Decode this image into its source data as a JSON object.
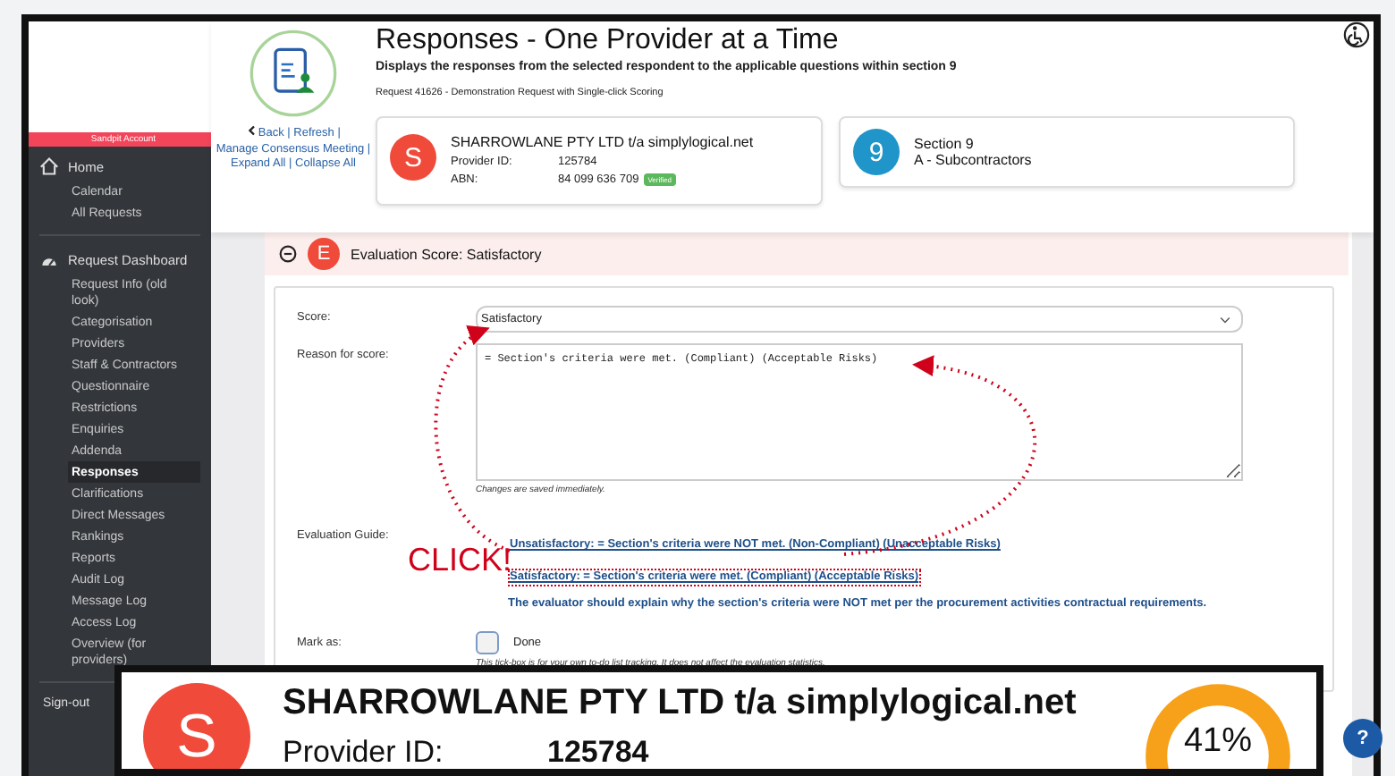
{
  "header": {
    "title": "Responses - One Provider at a Time",
    "subtitle": "Displays the responses from the selected respondent to the applicable questions within section 9",
    "request_line": "Request 41626 - Demonstration Request with Single-click Scoring",
    "links": [
      "Back",
      "Refresh",
      "Manage Consensus Meeting",
      "Expand All",
      "Collapse All"
    ],
    "link_separator": "|"
  },
  "provider_card": {
    "initial": "S",
    "name": "SHARROWLANE PTY LTD t/a simplylogical.net",
    "fields": [
      {
        "label": "Provider ID:",
        "value": "125784"
      },
      {
        "label": "ABN:",
        "value": "84 099 636 709",
        "badge": "Verified"
      }
    ]
  },
  "section_card": {
    "number": "9",
    "title": "Section 9",
    "subtitle": "A - Subcontractors"
  },
  "sidebar": {
    "banner": "Sandpit Account",
    "groups": [
      {
        "label": "Home",
        "children": [
          {
            "label": "Calendar",
            "selected": false
          },
          {
            "label": "All Requests",
            "selected": false
          }
        ]
      },
      {
        "label": "Request Dashboard",
        "children": [
          {
            "label": "Request Info (old look)",
            "selected": false
          },
          {
            "label": "Categorisation",
            "selected": false
          },
          {
            "label": "Providers",
            "selected": false
          },
          {
            "label": "Staff & Contractors",
            "selected": false
          },
          {
            "label": "Questionnaire",
            "selected": false
          },
          {
            "label": "Restrictions",
            "selected": false
          },
          {
            "label": "Enquiries",
            "selected": false
          },
          {
            "label": "Addenda",
            "selected": false
          },
          {
            "label": "Responses",
            "selected": true
          },
          {
            "label": "Clarifications",
            "selected": false
          },
          {
            "label": "Direct Messages",
            "selected": false
          },
          {
            "label": "Rankings",
            "selected": false
          },
          {
            "label": "Reports",
            "selected": false
          },
          {
            "label": "Audit Log",
            "selected": false
          },
          {
            "label": "Message Log",
            "selected": false
          },
          {
            "label": "Access Log",
            "selected": false
          },
          {
            "label": "Overview (for providers)",
            "selected": false
          }
        ]
      }
    ],
    "sign_out": "Sign-out"
  },
  "evaluation": {
    "badge": "E",
    "title": "Evaluation Score: Satisfactory",
    "expanded": true,
    "score_label": "Score:",
    "score_value": "Satisfactory",
    "reason_label": "Reason for score:",
    "reason_value": "= Section's criteria were met. (Compliant) (Acceptable Risks)",
    "reason_hint": "Changes are saved immediately.",
    "guide_label": "Evaluation Guide:",
    "guide_items": [
      {
        "text": "Unsatisfactory: = Section's criteria were NOT met.  (Non-Compliant) (Unacceptable Risks)",
        "highlighted": false
      },
      {
        "text": "Satisfactory: = Section's criteria were met. (Compliant) (Acceptable Risks)",
        "highlighted": true
      }
    ],
    "guide_note": "The evaluator should explain why the section's criteria were NOT met per the procurement activities contractual requirements.",
    "mark_label": "Mark as:",
    "done_label": "Done",
    "done_checked": false,
    "mark_hint": "This tick-box is for your own to-do list tracking.  It does not affect the evaluation statistics."
  },
  "annotation": {
    "text": "CLICK!"
  },
  "callout": {
    "initial": "S",
    "name": "SHARROWLANE PTY LTD t/a simplylogical.net",
    "id_label": "Provider ID:",
    "id_value": "125784",
    "percent": "41%"
  },
  "help": {
    "label": "?"
  }
}
